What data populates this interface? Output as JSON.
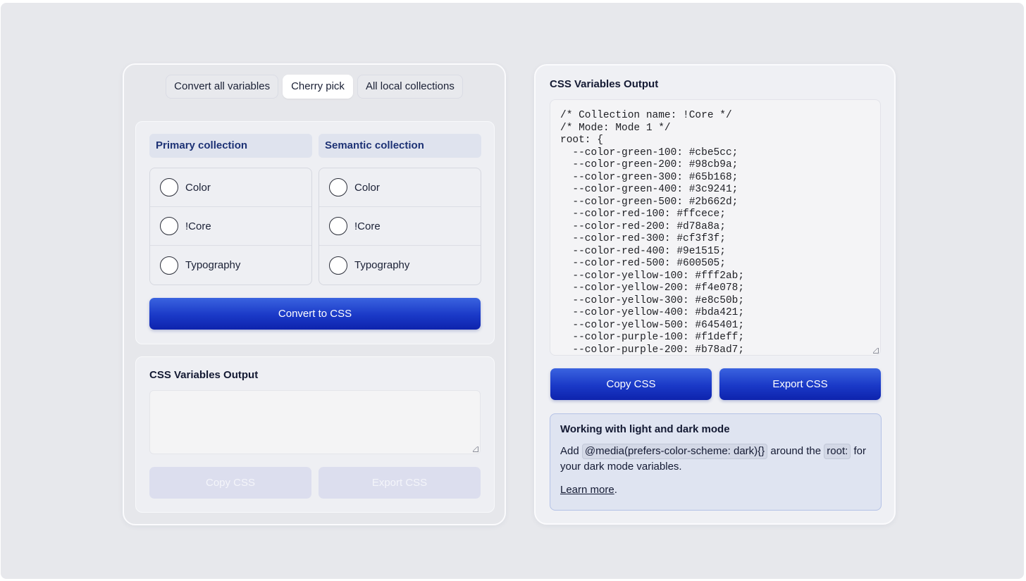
{
  "tabs": [
    {
      "label": "Convert all variables",
      "active": false
    },
    {
      "label": "Cherry pick",
      "active": true
    },
    {
      "label": "All local collections",
      "active": false
    }
  ],
  "primary": {
    "title": "Primary collection",
    "items": [
      "Color",
      "!Core",
      "Typography"
    ]
  },
  "semantic": {
    "title": "Semantic collection",
    "items": [
      "Color",
      "!Core",
      "Typography"
    ]
  },
  "convert_button": "Convert to CSS",
  "left_output": {
    "title": "CSS Variables Output",
    "copy_label": "Copy CSS",
    "export_label": "Export CSS"
  },
  "right_output": {
    "title": "CSS Variables Output",
    "code_lines": [
      "/* Collection name: !Core */",
      "/* Mode: Mode 1 */",
      "root: {",
      "  --color-green-100: #cbe5cc;",
      "  --color-green-200: #98cb9a;",
      "  --color-green-300: #65b168;",
      "  --color-green-400: #3c9241;",
      "  --color-green-500: #2b662d;",
      "  --color-red-100: #ffcece;",
      "  --color-red-200: #d78a8a;",
      "  --color-red-300: #cf3f3f;",
      "  --color-red-400: #9e1515;",
      "  --color-red-500: #600505;",
      "  --color-yellow-100: #fff2ab;",
      "  --color-yellow-200: #f4e078;",
      "  --color-yellow-300: #e8c50b;",
      "  --color-yellow-400: #bda421;",
      "  --color-yellow-500: #645401;",
      "  --color-purple-100: #f1deff;",
      "  --color-purple-200: #b78ad7;"
    ],
    "copy_label": "Copy CSS",
    "export_label": "Export CSS"
  },
  "info": {
    "title": "Working with light and dark mode",
    "text_add": "Add",
    "code_media": "@media(prefers-color-scheme: dark){}",
    "text_around": "around the",
    "code_root": "root:",
    "text_rest": "for your dark mode variables.",
    "link": "Learn more",
    "link_suffix": "."
  },
  "colors": {
    "accent": "#1a39c7",
    "header_text": "#1d3275",
    "info_bg": "#dfe4f1",
    "disabled_btn": "#dcdeee"
  }
}
